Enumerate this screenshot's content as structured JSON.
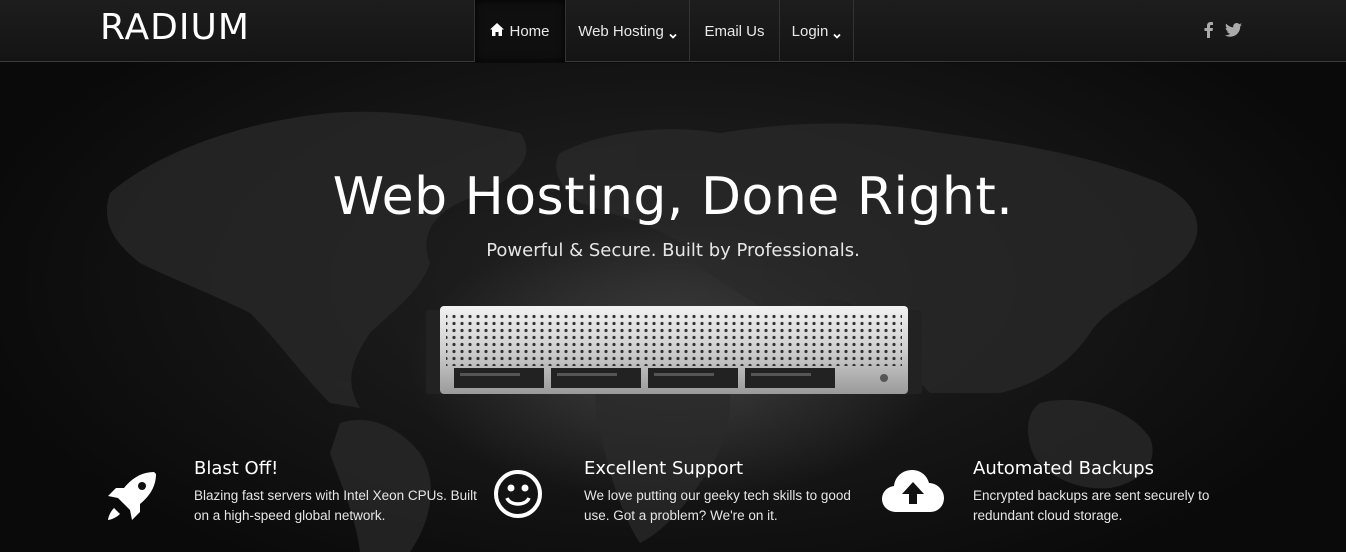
{
  "brand": {
    "logo_text": "RADIUM"
  },
  "nav": {
    "home_label": "Home",
    "hosting_label": "Web Hosting",
    "email_label": "Email Us",
    "login_label": "Login"
  },
  "social": {
    "facebook": "f",
    "twitter": "twitter-icon"
  },
  "hero": {
    "headline": "Web Hosting, Done Right.",
    "subline": "Powerful & Secure. Built by Professionals."
  },
  "features": [
    {
      "icon": "rocket-icon",
      "title": "Blast Off!",
      "text": "Blazing fast servers with Intel Xeon CPUs. Built on a high-speed global network."
    },
    {
      "icon": "smiley-icon",
      "title": "Excellent Support",
      "text": "We love putting our geeky tech skills to good use. Got a problem? We're on it."
    },
    {
      "icon": "cloud-upload-icon",
      "title": "Automated Backups",
      "text": "Encrypted backups are sent securely to redundant cloud storage."
    }
  ],
  "colors": {
    "background": "#0b0b0b",
    "navbar": "#1a1a1a",
    "text": "#ffffff"
  }
}
